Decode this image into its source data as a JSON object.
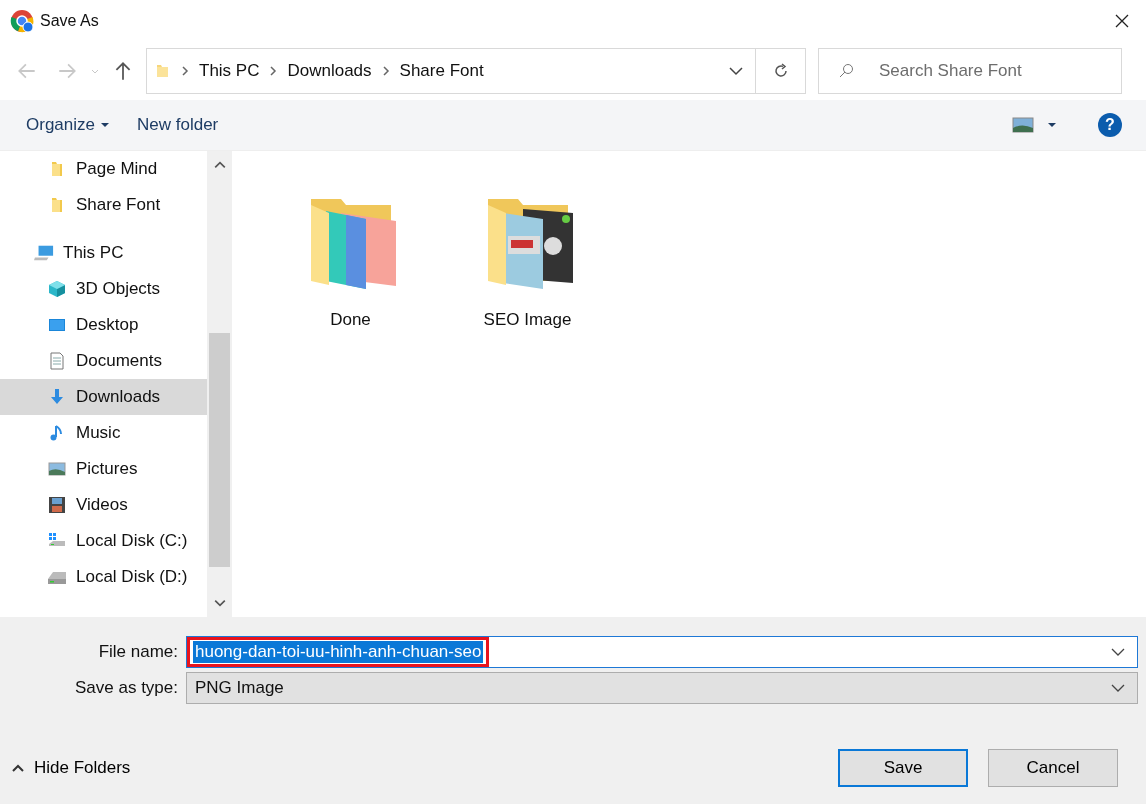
{
  "window": {
    "title": "Save As"
  },
  "breadcrumb": [
    "This PC",
    "Downloads",
    "Share Font"
  ],
  "search": {
    "placeholder": "Search Share Font"
  },
  "toolbar": {
    "organize": "Organize",
    "new_folder": "New folder",
    "help": "?"
  },
  "sidebar": {
    "quick_access": [
      {
        "label": "Page Mind",
        "kind": "folder",
        "selected": false
      },
      {
        "label": "Share Font",
        "kind": "folder",
        "selected": false
      }
    ],
    "this_pc": {
      "label": "This PC",
      "selected": false,
      "children": [
        {
          "label": "3D Objects",
          "kind": "cube",
          "selected": false
        },
        {
          "label": "Desktop",
          "kind": "desktop",
          "selected": false
        },
        {
          "label": "Documents",
          "kind": "documents",
          "selected": false
        },
        {
          "label": "Downloads",
          "kind": "downloads",
          "selected": true
        },
        {
          "label": "Music",
          "kind": "music",
          "selected": false
        },
        {
          "label": "Pictures",
          "kind": "pictures",
          "selected": false
        },
        {
          "label": "Videos",
          "kind": "videos",
          "selected": false
        },
        {
          "label": "Local Disk (C:)",
          "kind": "system-disk",
          "selected": false
        },
        {
          "label": "Local Disk (D:)",
          "kind": "disk",
          "selected": false
        }
      ]
    }
  },
  "files": [
    {
      "name": "Done",
      "kind": "gradient-folder"
    },
    {
      "name": "SEO Image",
      "kind": "photo-folder"
    }
  ],
  "form": {
    "file_name_label": "File name:",
    "file_name": "huong-dan-toi-uu-hinh-anh-chuan-seo",
    "type_label": "Save as type:",
    "type": "PNG Image"
  },
  "hide_folders": "Hide Folders",
  "buttons": {
    "save": "Save",
    "cancel": "Cancel"
  }
}
